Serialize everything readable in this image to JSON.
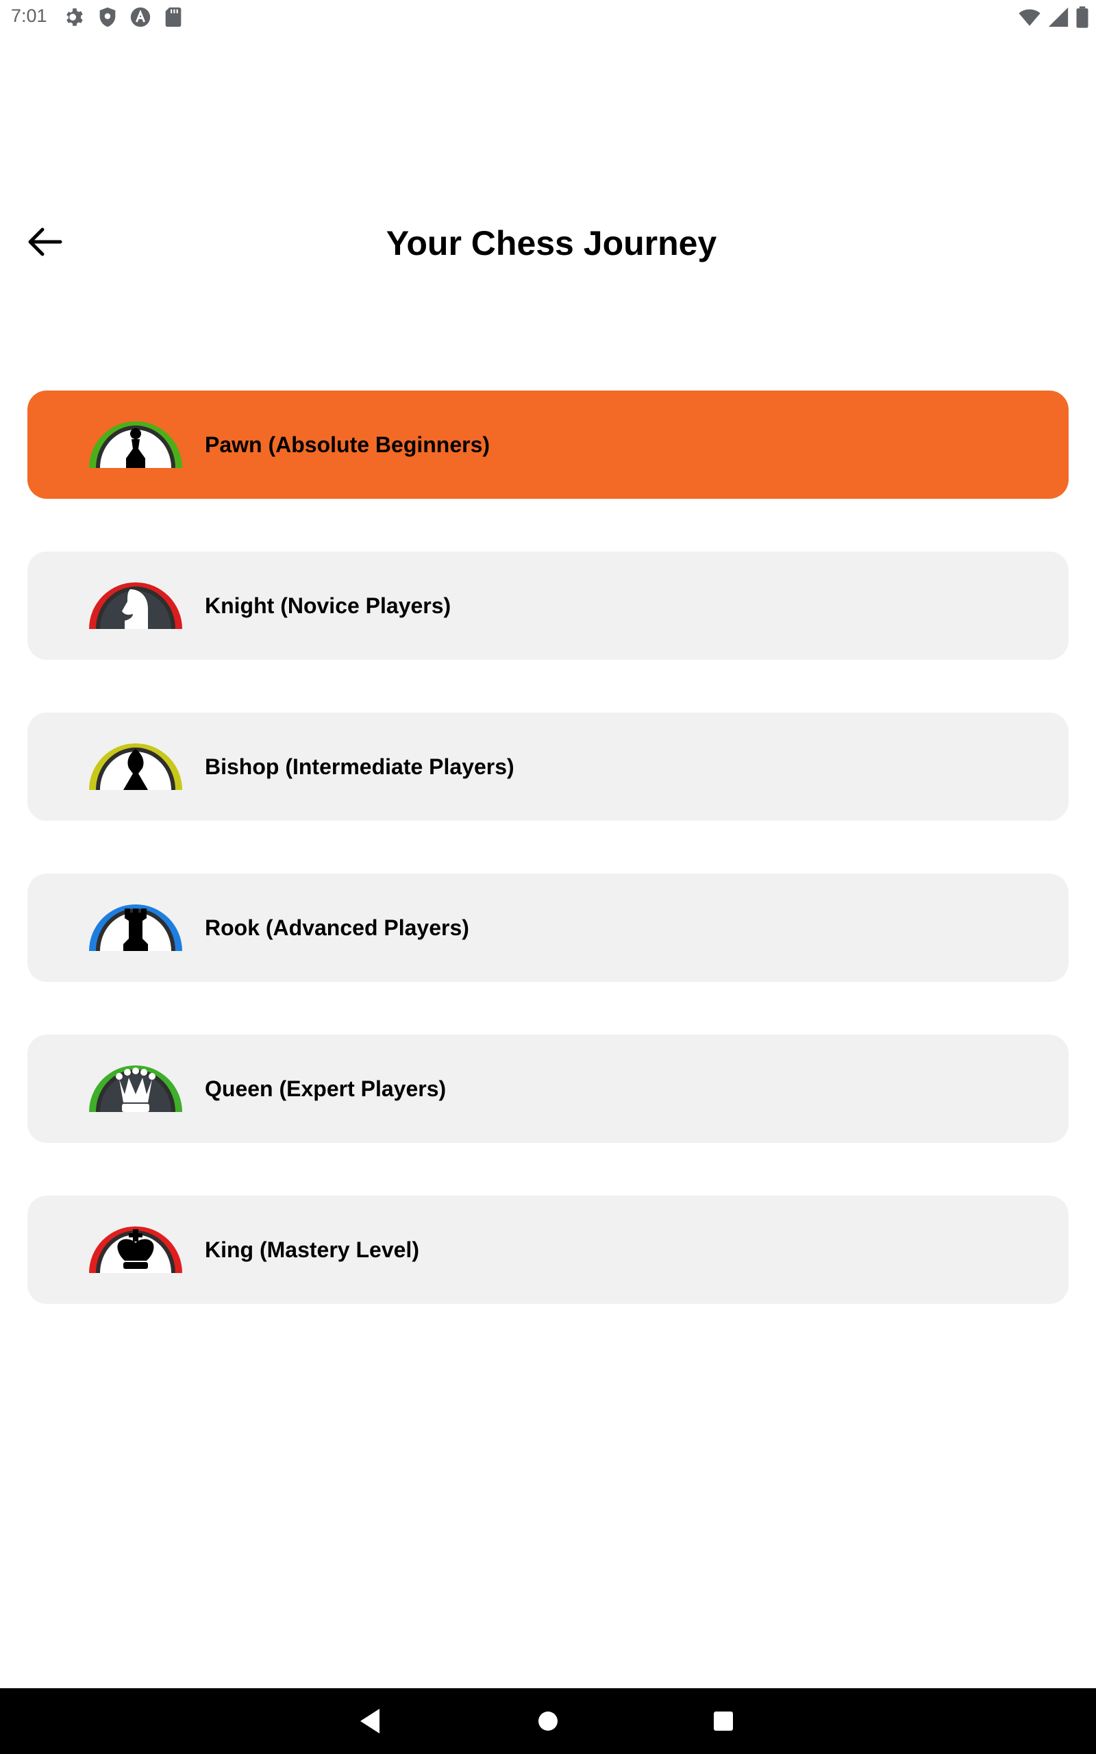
{
  "status_bar": {
    "time": "7:01",
    "left_icons": [
      "settings-icon",
      "shield-icon",
      "a-circle-icon",
      "sd-card-icon"
    ],
    "right_icons": [
      "wifi-icon",
      "cell-signal-icon",
      "battery-icon"
    ]
  },
  "header": {
    "title": "Your Chess Journey",
    "back_icon": "arrow-left-icon"
  },
  "levels": [
    {
      "label": "Pawn (Absolute Beginners)",
      "icon": "pawn-icon",
      "ring_color": "#4caf1a",
      "selected": true
    },
    {
      "label": "Knight (Novice Players)",
      "icon": "knight-icon",
      "ring_color": "#d81e1e",
      "selected": false
    },
    {
      "label": "Bishop (Intermediate Players)",
      "icon": "bishop-icon",
      "ring_color": "#c8c81a",
      "selected": false
    },
    {
      "label": "Rook (Advanced Players)",
      "icon": "rook-icon",
      "ring_color": "#1e7ee0",
      "selected": false
    },
    {
      "label": "Queen (Expert Players)",
      "icon": "queen-icon",
      "ring_color": "#3fae2a",
      "selected": false
    },
    {
      "label": "King (Mastery Level)",
      "icon": "king-icon",
      "ring_color": "#e01e1e",
      "selected": false
    }
  ],
  "colors": {
    "accent": "#f26a26",
    "card_background": "#f1f1f1"
  },
  "nav_bar": {
    "buttons": [
      "back-triangle-icon",
      "home-circle-icon",
      "recents-square-icon"
    ]
  }
}
